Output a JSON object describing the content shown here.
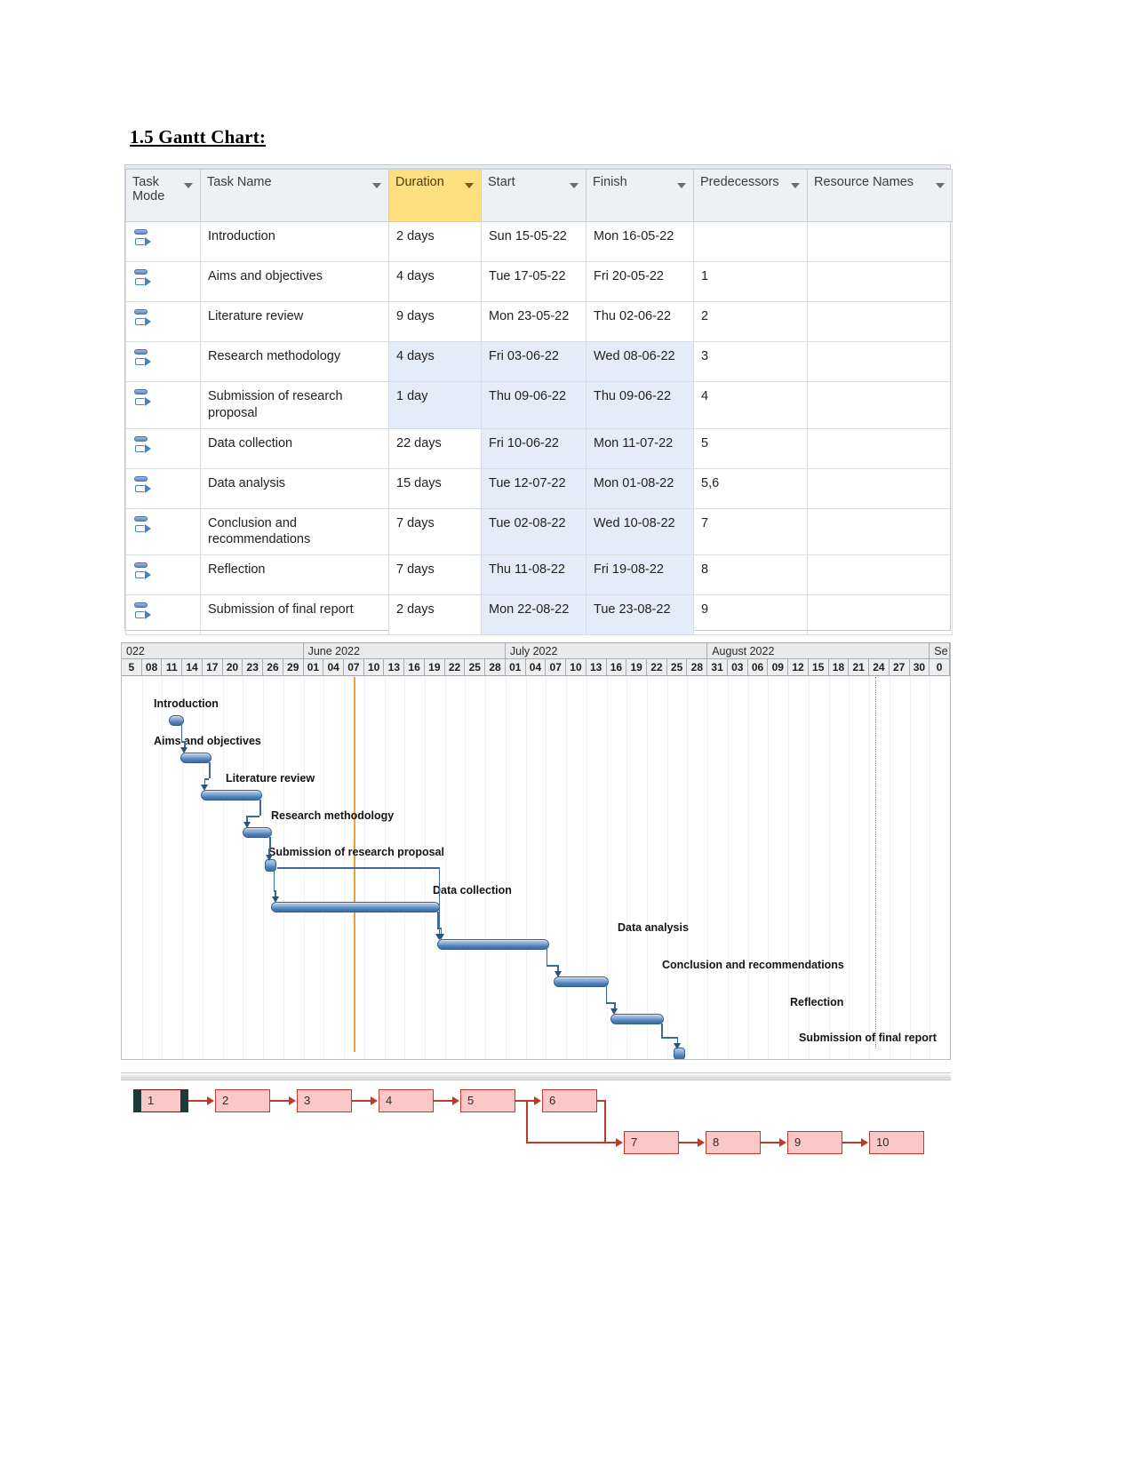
{
  "document": {
    "heading": "1.5 Gantt Chart:"
  },
  "grid": {
    "columns": [
      {
        "label": "Task Mode",
        "highlighted": false
      },
      {
        "label": "Task Name",
        "highlighted": false
      },
      {
        "label": "Duration",
        "highlighted": true
      },
      {
        "label": "Start",
        "highlighted": false
      },
      {
        "label": "Finish",
        "highlighted": false
      },
      {
        "label": "Predecessors",
        "highlighted": false
      },
      {
        "label": "Resource Names",
        "highlighted": false
      }
    ],
    "rows": [
      {
        "id": 1,
        "mode_icon": "auto-scheduled-icon",
        "name": "Introduction",
        "duration": "2 days",
        "start": "Sun 15-05-22",
        "finish": "Mon 16-05-22",
        "predecessors": "",
        "resources": ""
      },
      {
        "id": 2,
        "mode_icon": "auto-scheduled-icon",
        "name": "Aims and objectives",
        "duration": "4 days",
        "start": "Tue 17-05-22",
        "finish": "Fri 20-05-22",
        "predecessors": "1",
        "resources": ""
      },
      {
        "id": 3,
        "mode_icon": "auto-scheduled-icon",
        "name": "Literature review",
        "duration": "9 days",
        "start": "Mon 23-05-22",
        "finish": "Thu 02-06-22",
        "predecessors": "2",
        "resources": ""
      },
      {
        "id": 4,
        "mode_icon": "auto-scheduled-icon",
        "name": "Research methodology",
        "duration": "4 days",
        "start": "Fri 03-06-22",
        "finish": "Wed 08-06-22",
        "predecessors": "3",
        "resources": ""
      },
      {
        "id": 5,
        "mode_icon": "auto-scheduled-icon",
        "name": "Submission of research proposal",
        "duration": "1 day",
        "start": "Thu 09-06-22",
        "finish": "Thu 09-06-22",
        "predecessors": "4",
        "resources": ""
      },
      {
        "id": 6,
        "mode_icon": "auto-scheduled-icon",
        "name": "Data collection",
        "duration": "22 days",
        "start": "Fri 10-06-22",
        "finish": "Mon 11-07-22",
        "predecessors": "5",
        "resources": ""
      },
      {
        "id": 7,
        "mode_icon": "auto-scheduled-icon",
        "name": "Data analysis",
        "duration": "15 days",
        "start": "Tue 12-07-22",
        "finish": "Mon 01-08-22",
        "predecessors": "5,6",
        "resources": ""
      },
      {
        "id": 8,
        "mode_icon": "auto-scheduled-icon",
        "name": "Conclusion and recommendations",
        "duration": "7 days",
        "start": "Tue 02-08-22",
        "finish": "Wed 10-08-22",
        "predecessors": "7",
        "resources": ""
      },
      {
        "id": 9,
        "mode_icon": "auto-scheduled-icon",
        "name": "Reflection",
        "duration": "7 days",
        "start": "Thu 11-08-22",
        "finish": "Fri 19-08-22",
        "predecessors": "8",
        "resources": ""
      },
      {
        "id": 10,
        "mode_icon": "auto-scheduled-icon",
        "name": "Submission of final report",
        "duration": "2 days",
        "start": "Mon 22-08-22",
        "finish": "Tue 23-08-22",
        "predecessors": "9",
        "resources": ""
      }
    ]
  },
  "chart_data": {
    "type": "gantt",
    "title": "1.5 Gantt Chart:",
    "timescale": {
      "month_labels": [
        "022",
        "June 2022",
        "July 2022",
        "August 2022",
        "Se"
      ],
      "day_ticks": [
        "5",
        "08",
        "11",
        "14",
        "17",
        "20",
        "23",
        "26",
        "29",
        "01",
        "04",
        "07",
        "10",
        "13",
        "16",
        "19",
        "22",
        "25",
        "28",
        "01",
        "04",
        "07",
        "10",
        "13",
        "16",
        "19",
        "22",
        "25",
        "28",
        "31",
        "03",
        "06",
        "09",
        "12",
        "15",
        "18",
        "21",
        "24",
        "27",
        "30",
        "0"
      ],
      "today_marker_tick": "07",
      "finish_marker_tick": "24"
    },
    "bars": [
      {
        "task": "Introduction",
        "label": "Introduction",
        "duration_days": 2,
        "kind": "bar"
      },
      {
        "task": "Aims and objectives",
        "label": "Aims and objectives",
        "duration_days": 4,
        "kind": "bar"
      },
      {
        "task": "Literature review",
        "label": "Literature review",
        "duration_days": 9,
        "kind": "bar"
      },
      {
        "task": "Research methodology",
        "label": "Research methodology",
        "duration_days": 4,
        "kind": "bar"
      },
      {
        "task": "Submission of research proposal",
        "label": "Submission of research proposal",
        "duration_days": 1,
        "kind": "milestone"
      },
      {
        "task": "Data collection",
        "label": "Data collection",
        "duration_days": 22,
        "kind": "bar"
      },
      {
        "task": "Data analysis",
        "label": "Data analysis",
        "duration_days": 15,
        "kind": "bar"
      },
      {
        "task": "Conclusion and recommendations",
        "label": "Conclusion and recommendations",
        "duration_days": 7,
        "kind": "bar"
      },
      {
        "task": "Reflection",
        "label": "Reflection",
        "duration_days": 7,
        "kind": "bar"
      },
      {
        "task": "Submission of final report",
        "label": "Submission of final report",
        "duration_days": 2,
        "kind": "milestone"
      }
    ],
    "dependencies": [
      {
        "from": 1,
        "to": 2
      },
      {
        "from": 2,
        "to": 3
      },
      {
        "from": 3,
        "to": 4
      },
      {
        "from": 4,
        "to": 5
      },
      {
        "from": 5,
        "to": 6
      },
      {
        "from": 5,
        "to": 7
      },
      {
        "from": 6,
        "to": 7
      },
      {
        "from": 7,
        "to": 8
      },
      {
        "from": 8,
        "to": 9
      },
      {
        "from": 9,
        "to": 10
      }
    ]
  },
  "network": {
    "nodes": [
      {
        "id": "1",
        "critical_start": true
      },
      {
        "id": "2",
        "critical_start": false
      },
      {
        "id": "3",
        "critical_start": false
      },
      {
        "id": "4",
        "critical_start": false
      },
      {
        "id": "5",
        "critical_start": false
      },
      {
        "id": "6",
        "critical_start": false
      },
      {
        "id": "7",
        "critical_start": false
      },
      {
        "id": "8",
        "critical_start": false
      },
      {
        "id": "9",
        "critical_start": false
      },
      {
        "id": "10",
        "critical_start": false
      }
    ]
  }
}
